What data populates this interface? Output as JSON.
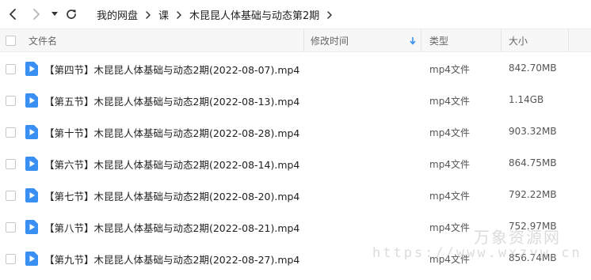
{
  "nav": {
    "back_icon": "chevron-left-icon",
    "forward_icon": "chevron-right-icon",
    "dropdown_icon": "caret-down-icon",
    "refresh_icon": "refresh-icon",
    "breadcrumb": [
      "我的网盘",
      "课",
      "木昆昆人体基础与动态第2期"
    ]
  },
  "columns": {
    "name": "文件名",
    "modified": "修改时间",
    "type": "类型",
    "size": "大小",
    "sort_icon": "arrow-down-icon"
  },
  "files": [
    {
      "name": "【第四节】木昆昆人体基础与动态2期(2022-08-07).mp4",
      "type": "mp4文件",
      "size": "842.70MB"
    },
    {
      "name": "【第五节】木昆昆人体基础与动态2期(2022-08-13).mp4",
      "type": "mp4文件",
      "size": "1.14GB"
    },
    {
      "name": "【第十节】木昆昆人体基础与动态2期(2022-08-28).mp4",
      "type": "mp4文件",
      "size": "903.32MB"
    },
    {
      "name": "【第六节】木昆昆人体基础与动态2期(2022-08-14).mp4",
      "type": "mp4文件",
      "size": "864.75MB"
    },
    {
      "name": "【第七节】木昆昆人体基础与动态2期(2022-08-20).mp4",
      "type": "mp4文件",
      "size": "792.22MB"
    },
    {
      "name": "【第八节】木昆昆人体基础与动态2期(2022-08-21).mp4",
      "type": "mp4文件",
      "size": "752.97MB"
    },
    {
      "name": "【第九节】木昆昆人体基础与动态2期(2022-08-27).mp4",
      "type": "mp4文件",
      "size": "856.74MB"
    }
  ],
  "watermark": {
    "cn": "万象资源网",
    "url": "https://www.wxzyw.cn"
  },
  "colors": {
    "video_icon": "#3a8ff3",
    "sort_arrow": "#3a8ff3",
    "header_bg": "#f7f7f7"
  }
}
